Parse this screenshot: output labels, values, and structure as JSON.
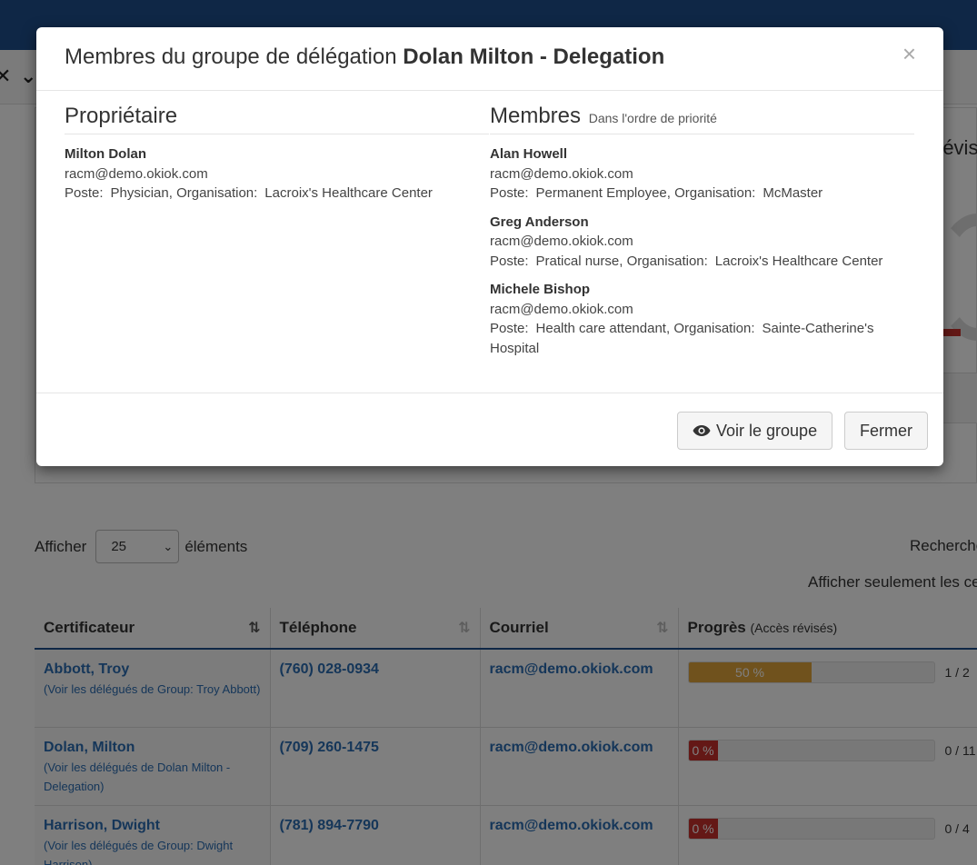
{
  "background": {
    "panel_title_fragment": "révis",
    "length": {
      "label_before": "Afficher",
      "selected": "25",
      "label_after": "éléments"
    },
    "search_label": "Recherche",
    "filter_label": "Afficher seulement les ce",
    "table": {
      "headers": [
        {
          "label": "Certificateur"
        },
        {
          "label": "Téléphone"
        },
        {
          "label": "Courriel"
        },
        {
          "label": "Progrès",
          "sub": "(Accès révisés)"
        }
      ],
      "rows": [
        {
          "name": "Abbott, Troy",
          "delegates": "(Voir les délégués de Group: Troy Abbott)",
          "phone": "(760) 028-0934",
          "email": "racm@demo.okiok.com",
          "progress_label": "50 %",
          "progress_fraction": 0.5,
          "count": "1 / 2"
        },
        {
          "name": "Dolan, Milton",
          "delegates": "(Voir les délégués de Dolan Milton - Delegation)",
          "phone": "(709) 260-1475",
          "email": "racm@demo.okiok.com",
          "progress_label": "0 %",
          "progress_fraction": 0,
          "count": "0 / 11"
        },
        {
          "name": "Harrison, Dwight",
          "delegates": "(Voir les délégués de Group: Dwight Harrison)",
          "phone": "(781) 894-7790",
          "email": "racm@demo.okiok.com",
          "progress_label": "0 %",
          "progress_fraction": 0,
          "count": "0 / 4"
        }
      ]
    }
  },
  "modal": {
    "title_prefix": "Membres du groupe de délégation",
    "title_group": "Dolan Milton - Delegation",
    "close_symbol": "×",
    "owner": {
      "heading": "Propriétaire",
      "name": "Milton Dolan",
      "email": "racm@demo.okiok.com",
      "poste_label": "Poste:",
      "poste": "Physician,",
      "org_label": "Organisation:",
      "org": "Lacroix's Healthcare Center"
    },
    "members": {
      "heading": "Membres",
      "subheading": "Dans l'ordre de priorité",
      "items": [
        {
          "name": "Alan Howell",
          "email": "racm@demo.okiok.com",
          "poste_label": "Poste:",
          "poste": "Permanent Employee,",
          "org_label": "Organisation:",
          "org": "McMaster"
        },
        {
          "name": "Greg Anderson",
          "email": "racm@demo.okiok.com",
          "poste_label": "Poste:",
          "poste": "Pratical nurse,",
          "org_label": "Organisation:",
          "org": "Lacroix's Healthcare Center"
        },
        {
          "name": "Michele Bishop",
          "email": "racm@demo.okiok.com",
          "poste_label": "Poste:",
          "poste": "Health care attendant,",
          "org_label": "Organisation:",
          "org": "Sainte-Catherine's Hospital"
        }
      ]
    },
    "buttons": {
      "view_group": "Voir le groupe",
      "close": "Fermer"
    }
  },
  "colors": {
    "brand": "#1f4e8c",
    "link": "#2a6cb3",
    "progress_warning": "#e0a43a",
    "progress_danger": "#c9302c"
  },
  "icons": {
    "view_button": "eye-icon",
    "sort": "sort-icon",
    "select": "chevron-down-icon"
  }
}
